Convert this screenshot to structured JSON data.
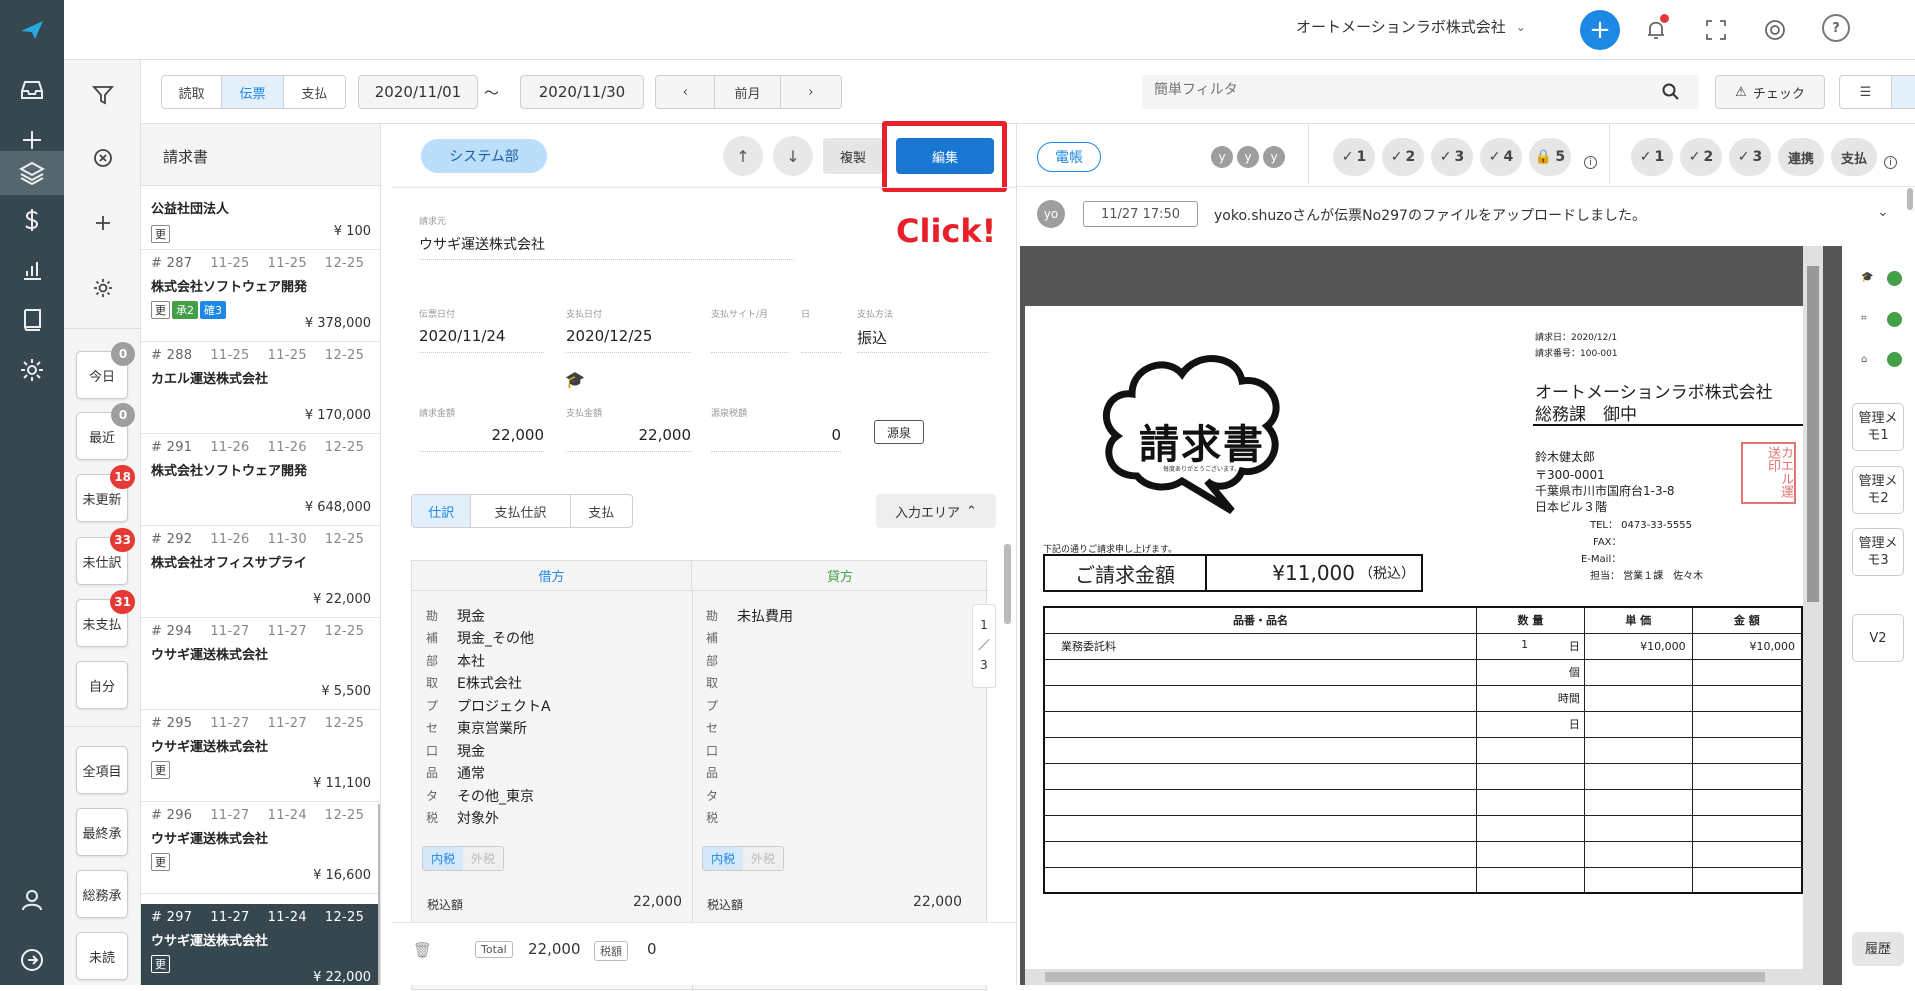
{
  "colors": {
    "accent": "#1e88e5",
    "rail": "#37474f",
    "danger": "#e53935",
    "green": "#43a047",
    "teal": "#26a69a",
    "highlight_red": "#e8202a"
  },
  "icons": {
    "logo": "paper-plane-logo",
    "rail": [
      "inbox-icon",
      "plus-icon",
      "layers-icon",
      "dollar-icon",
      "bar-chart-icon",
      "book-icon",
      "gear-icon",
      "user-icon",
      "logout-icon"
    ],
    "leftnav": [
      "filter-icon",
      "clear-filter-icon",
      "add-icon",
      "settings-icon"
    ]
  },
  "header": {
    "company": "オートメーションラボ株式会社"
  },
  "toolbar": {
    "type_tabs": [
      "読取",
      "伝票",
      "支払"
    ],
    "date_from": "2020/11/01",
    "range_sep": "〜",
    "date_to": "2020/11/30",
    "prev_month": "前月",
    "filter_placeholder": "簡単フィルタ",
    "check_label": "チェック"
  },
  "leftnav": {
    "filters": [
      {
        "label": "今日",
        "count": "0"
      },
      {
        "label": "最近",
        "count": "0"
      },
      {
        "label": "未更新",
        "count": "18"
      },
      {
        "label": "未仕訳",
        "count": "33"
      },
      {
        "label": "未支払",
        "count": "31"
      },
      {
        "label": "自分",
        "count": ""
      },
      {
        "label": "全項目",
        "count": ""
      },
      {
        "label": "最終承",
        "count": ""
      },
      {
        "label": "総務承",
        "count": ""
      },
      {
        "label": "未読",
        "count": ""
      }
    ]
  },
  "list": {
    "title": "請求書",
    "partial": {
      "name": "公益社団法人",
      "tag": "更",
      "amount": "¥ 100"
    },
    "items": [
      {
        "no": "# 287",
        "d1": "11-25",
        "d2": "11-25",
        "d3": "12-25",
        "name": "株式会社ソフトウェア開発",
        "tags": [
          "更",
          "承2",
          "確3"
        ],
        "amount": "¥ 378,000"
      },
      {
        "no": "# 288",
        "d1": "11-25",
        "d2": "11-25",
        "d3": "12-25",
        "name": "カエル運送株式会社",
        "tags": [],
        "amount": "¥ 170,000"
      },
      {
        "no": "# 291",
        "d1": "11-26",
        "d2": "11-26",
        "d3": "12-25",
        "name": "株式会社ソフトウェア開発",
        "tags": [],
        "amount": "¥ 648,000"
      },
      {
        "no": "# 292",
        "d1": "11-26",
        "d2": "11-30",
        "d3": "12-25",
        "name": "株式会社オフィスサプライ",
        "tags": [],
        "amount": "¥ 22,000"
      },
      {
        "no": "# 294",
        "d1": "11-27",
        "d2": "11-27",
        "d3": "12-25",
        "name": "ウサギ運送株式会社",
        "tags": [],
        "amount": "¥ 5,500"
      },
      {
        "no": "# 295",
        "d1": "11-27",
        "d2": "11-27",
        "d3": "12-25",
        "name": "ウサギ運送株式会社",
        "tags": [
          "更"
        ],
        "amount": "¥ 11,100"
      },
      {
        "no": "# 296",
        "d1": "11-27",
        "d2": "11-24",
        "d3": "12-25",
        "name": "ウサギ運送株式会社",
        "tags": [
          "更"
        ],
        "amount": "¥ 16,600"
      },
      {
        "no": "# 297",
        "d1": "11-27",
        "d2": "11-24",
        "d3": "12-25",
        "name": "ウサギ運送株式会社",
        "tags": [
          "更"
        ],
        "amount": "¥ 22,000"
      }
    ]
  },
  "form": {
    "department": "システム部",
    "copy_label": "複製",
    "edit_label": "編集",
    "click_note": "Click!",
    "vendor_label": "請求元",
    "vendor": "ウサギ運送株式会社",
    "voucher_date_label": "伝票日付",
    "voucher_date": "2020/11/24",
    "pay_date_label": "支払日付",
    "pay_date": "2020/12/25",
    "pay_site_label": "支払サイト/月",
    "day_label": "日",
    "method_label": "支払方法",
    "method": "振込",
    "invoice_amount_label": "請求金額",
    "invoice_amount": "22,000",
    "pay_amount_label": "支払金額",
    "pay_amount": "22,000",
    "withholding_label": "源泉税額",
    "withholding": "0",
    "withholding_btn": "源泉",
    "tabs": [
      "仕訳",
      "支払仕訳",
      "支払"
    ],
    "input_area": "入力エリア",
    "debit_header": "借方",
    "credit_header": "貸方",
    "row_labels": [
      "勘",
      "補",
      "部",
      "取",
      "プ",
      "セ",
      "口",
      "品",
      "タ",
      "税"
    ],
    "debit_values": [
      "現金",
      "現金_その他",
      "本社",
      "E株式会社",
      "プロジェクトA",
      "東京営業所",
      "現金",
      "通常",
      "その他_東京",
      "対象外"
    ],
    "credit_values": [
      "未払費用",
      "",
      "",
      "",
      "",
      "",
      "",
      "",
      "",
      ""
    ],
    "tax_incl": "内税",
    "tax_excl": "外税",
    "taxed_label": "税込額",
    "debit_taxed": "22,000",
    "credit_taxed": "22,000",
    "pager": [
      "1",
      "／",
      "3"
    ],
    "total_label": "Total",
    "total": "22,000",
    "tax_label": "税額",
    "tax": "0"
  },
  "viewer": {
    "ledger_btn": "電帳",
    "avatars": [
      "y",
      "y",
      "y"
    ],
    "approvals": [
      "1",
      "2",
      "3",
      "4",
      "5"
    ],
    "checks": [
      "1",
      "2",
      "3"
    ],
    "link_label": "連携",
    "pay_label": "支払",
    "log": {
      "avatar": "yo",
      "time": "11/27 17:50",
      "message": "yoko.shuzoさんが伝票No297のファイルをアップロードしました。"
    },
    "side_buttons": [
      "管理メモ1",
      "管理メモ2",
      "管理メモ3",
      "V2",
      "履歴"
    ]
  },
  "invoice": {
    "title": "請求書",
    "subtitle": "毎度ありがとうございます。",
    "date": "請求日：2020/12/1",
    "number": "請求番号：100-001",
    "to_company": "オートメーションラボ株式会社",
    "to_dept": "総務課　御中",
    "from_name": "鈴木健太郎",
    "zip": "〒300-0001",
    "addr1": "千葉県市川市国府台1-3-8",
    "addr2": "日本ビル３階",
    "tel": "TEL：  0473-33-5555",
    "fax": "FAX：",
    "email": "E-Mail：",
    "staff": "担当：  営業１課　佐々木",
    "stamp": "カエル運送印",
    "intro": "下記の通りご請求申し上げます。",
    "amount_label": "ご請求金額",
    "amount": "¥11,000",
    "amount_note": "（税込）",
    "col_item": "品番・品名",
    "col_qty": "数 量",
    "col_price": "単 価",
    "col_total": "金 額",
    "row1_item": "業務委託料",
    "row1_qty": "1",
    "row1_unit": "日",
    "row1_price": "¥10,000",
    "row1_total": "¥10,000",
    "unit_options": [
      "個",
      "時間",
      "日"
    ]
  }
}
